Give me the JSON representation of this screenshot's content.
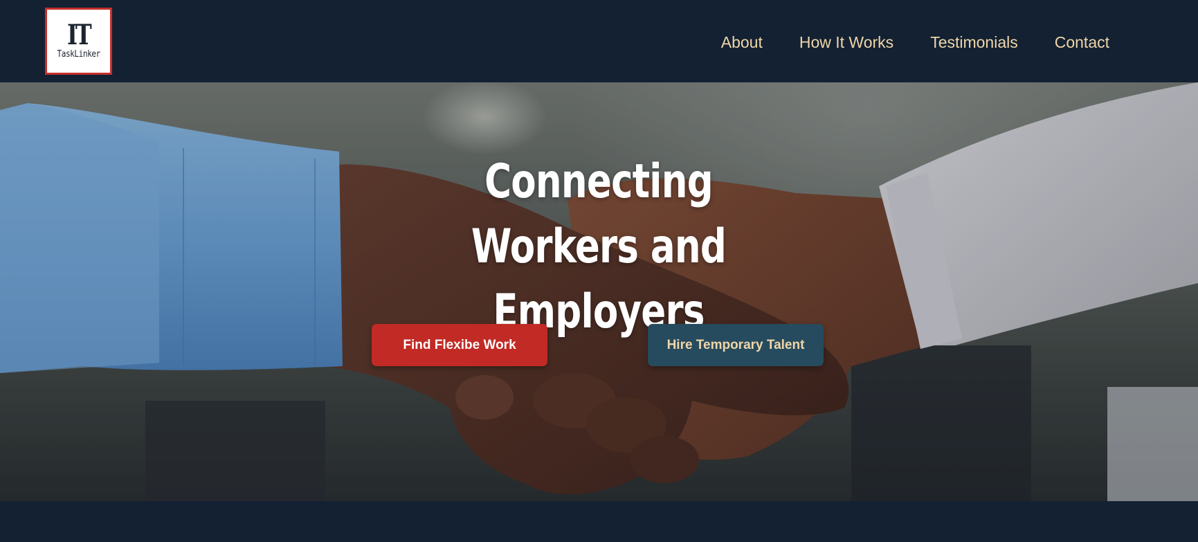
{
  "header": {
    "logo": {
      "mark": "IT",
      "wordmark": "TaskLinker"
    },
    "nav": [
      {
        "label": "About"
      },
      {
        "label": "How It Works"
      },
      {
        "label": "Testimonials"
      },
      {
        "label": "Contact"
      }
    ]
  },
  "hero": {
    "title_line1": "Connecting Workers and",
    "title_line2": "Employers",
    "primary_button": "Find Flexibe Work",
    "secondary_button": "Hire Temporary Talent",
    "background_image": "handshake-photo"
  },
  "colors": {
    "navy": "#132133",
    "accent_red": "#c22a25",
    "accent_teal": "#264b5e",
    "nav_text": "#f0d6a8"
  }
}
